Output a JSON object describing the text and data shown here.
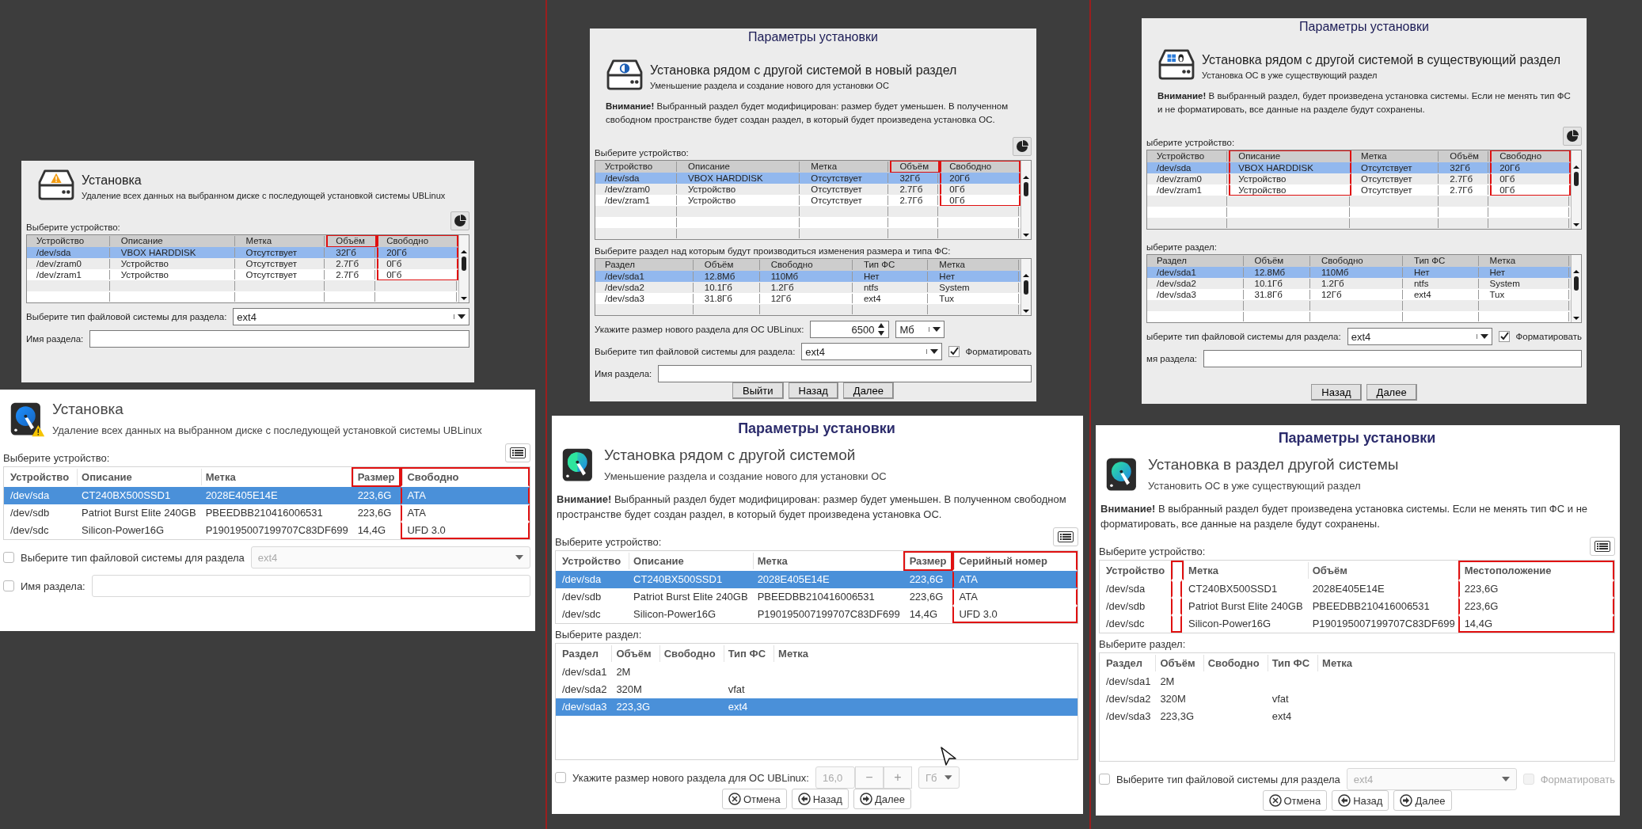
{
  "panels": [
    {
      "kind": "classic",
      "heading": "Установка",
      "subheading": "Удаление всех данных на выбранном диске с последующей установкой системы UBLinux",
      "device_prompt": "Выберите устройство:",
      "devices": {
        "columns": [
          {
            "label": "Устройство",
            "highlighted": false
          },
          {
            "label": "Описание",
            "highlighted": false
          },
          {
            "label": "Метка",
            "highlighted": false
          },
          {
            "label": "Объём",
            "highlighted": true,
            "rows_highlighted": false
          },
          {
            "label": "Свободно",
            "highlighted": true,
            "rows_highlighted": true
          }
        ],
        "rows": [
          {
            "cells": [
              "/dev/sda",
              "VBOX HARDDISK",
              "Отсутствует",
              "32Гб",
              "20Гб"
            ],
            "selected": true
          },
          {
            "cells": [
              "/dev/zram0",
              "Устройство",
              "Отсутствует",
              "2.7Гб",
              "0Гб"
            ],
            "selected": false
          },
          {
            "cells": [
              "/dev/zram1",
              "Устройство",
              "Отсутствует",
              "2.7Гб",
              "0Гб"
            ],
            "selected": false
          }
        ]
      },
      "fs_option": {
        "label": "Выберите тип файловой системы для раздела:",
        "value": "ext4"
      },
      "name_option": {
        "label": "Имя раздела:"
      }
    },
    {
      "kind": "modern",
      "heading": "Установка",
      "subheading": "Удаление всех данных на выбранном диске с последующей установкой системы UBLinux",
      "device_prompt": "Выберите устройство:",
      "devices": {
        "columns": [
          {
            "label": "Устройство",
            "highlighted": false
          },
          {
            "label": "Описание",
            "highlighted": false
          },
          {
            "label": "Метка",
            "highlighted": false
          },
          {
            "label": "Размер",
            "highlighted": true,
            "rows_highlighted": false
          },
          {
            "label": "Свободно",
            "highlighted": true,
            "rows_highlighted": true
          }
        ],
        "rows": [
          {
            "cells": [
              "/dev/sda",
              "CT240BX500SSD1",
              "2028E405E14E",
              "223,6G",
              "ATA"
            ],
            "selected": true
          },
          {
            "cells": [
              "/dev/sdb",
              "Patriot Burst Elite 240GB",
              "PBEEDBB210416006531",
              "223,6G",
              "ATA"
            ],
            "selected": false
          },
          {
            "cells": [
              "/dev/sdc",
              "Silicon-Power16G",
              "P190195007199707C83DF699",
              "14,4G",
              "UFD 3.0"
            ],
            "selected": false
          }
        ]
      },
      "fs_option": {
        "checked": false,
        "label": "Выберите тип файловой системы для раздела",
        "value": "ext4",
        "disabled": true
      },
      "name_option": {
        "checked": false,
        "label": "Имя раздела:"
      }
    },
    {
      "kind": "classic",
      "title": "Параметры установки",
      "heading": "Установка рядом с другой системой в новый раздел",
      "subheading": "Уменьшение раздела и создание нового для установки ОС",
      "warning": "**Внимание!** Выбранный раздел будет модифицирован: размер будет уменьшен. В полученном свободном пространстве будет создан раздел, в который будет произведена установка ОС.",
      "device_prompt": "Выберите устройство:",
      "devices": {
        "columns": [
          {
            "label": "Устройство",
            "highlighted": false
          },
          {
            "label": "Описание",
            "highlighted": false
          },
          {
            "label": "Метка",
            "highlighted": false
          },
          {
            "label": "Объём",
            "highlighted": true,
            "rows_highlighted": false
          },
          {
            "label": "Свободно",
            "highlighted": true,
            "rows_highlighted": true
          }
        ],
        "rows": [
          {
            "cells": [
              "/dev/sda",
              "VBOX HARDDISK",
              "Отсутствует",
              "32Гб",
              "20Гб"
            ],
            "selected": true
          },
          {
            "cells": [
              "/dev/zram0",
              "Устройство",
              "Отсутствует",
              "2.7Гб",
              "0Гб"
            ],
            "selected": false
          },
          {
            "cells": [
              "/dev/zram1",
              "Устройство",
              "Отсутствует",
              "2.7Гб",
              "0Гб"
            ],
            "selected": false
          }
        ]
      },
      "partition_prompt": "Выберите раздел над которым будут производиться изменения размера и типа ФС:",
      "partitions": {
        "columns": [
          {
            "label": "Раздел",
            "highlighted": false
          },
          {
            "label": "Объём",
            "highlighted": false
          },
          {
            "label": "Свободно",
            "highlighted": false
          },
          {
            "label": "Тип ФС",
            "highlighted": false
          },
          {
            "label": "Метка",
            "highlighted": false
          }
        ],
        "rows": [
          {
            "cells": [
              "/dev/sda1",
              "12.8Мб",
              "110Мб",
              "Нет",
              "Нет"
            ],
            "selected": true
          },
          {
            "cells": [
              "/dev/sda2",
              "10.1Гб",
              "1.2Гб",
              "ntfs",
              "System"
            ],
            "selected": false
          },
          {
            "cells": [
              "/dev/sda3",
              "31.8Гб",
              "12Гб",
              "ext4",
              "Tux"
            ],
            "selected": false
          }
        ]
      },
      "size_option": {
        "label": "Укажите размер нового раздела для ОС UBLinux:",
        "value": "6500",
        "unit": "Мб"
      },
      "fs_option": {
        "label": "Выберите тип файловой системы для раздела:",
        "value": "ext4",
        "format": {
          "label": "Форматировать",
          "checked": true
        }
      },
      "name_option": {
        "label": "Имя раздела:"
      },
      "buttons": [
        {
          "kind": "exit",
          "label": "Выйти"
        },
        {
          "kind": "back",
          "label": "Назад"
        },
        {
          "kind": "next",
          "label": "Далее"
        }
      ]
    },
    {
      "kind": "modern",
      "title": "Параметры установки",
      "heading": "Установка рядом с другой системой",
      "subheading": "Уменьшение раздела и создание нового для установки ОС",
      "warning": "**Внимание!** Выбранный раздел будет модифицирован: размер будет уменьшен. В полученном свободном пространстве будет создан раздел, в который будет произведена установка ОС.",
      "device_prompt": "Выберите устройство:",
      "devices": {
        "columns": [
          {
            "label": "Устройство",
            "highlighted": false
          },
          {
            "label": "Описание",
            "highlighted": false
          },
          {
            "label": "Метка",
            "highlighted": false
          },
          {
            "label": "Размер",
            "highlighted": true,
            "rows_highlighted": false
          },
          {
            "label": "Серийный номер",
            "highlighted": true,
            "rows_highlighted": true
          }
        ],
        "rows": [
          {
            "cells": [
              "/dev/sda",
              "CT240BX500SSD1",
              "2028E405E14E",
              "223,6G",
              "ATA"
            ],
            "selected": true
          },
          {
            "cells": [
              "/dev/sdb",
              "Patriot Burst Elite 240GB",
              "PBEEDBB210416006531",
              "223,6G",
              "ATA"
            ],
            "selected": false
          },
          {
            "cells": [
              "/dev/sdc",
              "Silicon-Power16G",
              "P190195007199707C83DF699",
              "14,4G",
              "UFD 3.0"
            ],
            "selected": false
          }
        ]
      },
      "partition_prompt": "Выберите раздел:",
      "partitions": {
        "columns": [
          {
            "label": "Раздел",
            "highlighted": false
          },
          {
            "label": "Объём",
            "highlighted": false
          },
          {
            "label": "Свободно",
            "highlighted": false
          },
          {
            "label": "Тип ФС",
            "highlighted": false
          },
          {
            "label": "Метка",
            "highlighted": false
          }
        ],
        "rows": [
          {
            "cells": [
              "/dev/sda1",
              "2M",
              null,
              null,
              null
            ],
            "selected": false
          },
          {
            "cells": [
              "/dev/sda2",
              "320M",
              null,
              "vfat",
              null
            ],
            "selected": false
          },
          {
            "cells": [
              "/dev/sda3",
              "223,3G",
              null,
              "ext4",
              null
            ],
            "selected": true
          }
        ]
      },
      "size_option": {
        "checked": false,
        "label": "Укажите размер нового раздела для ОС UBLinux:",
        "value": "16,0",
        "stepper": [
          "−",
          "+"
        ],
        "unit": "Гб",
        "disabled": true
      },
      "buttons": [
        {
          "kind": "cancel",
          "label": "Отмена"
        },
        {
          "kind": "back",
          "label": "Назад"
        },
        {
          "kind": "next",
          "label": "Далее"
        }
      ]
    },
    {
      "kind": "classic",
      "title": "Параметры установки",
      "heading": "Установка рядом с другой системой в существующий раздел",
      "subheading": "Установка ОС в уже существующий раздел",
      "warning": "**Внимание!** В выбранный раздел, будет произведена установка системы. Если не менять тип ФС и не форматировать, все данные на разделе будут сохранены.",
      "device_prompt": "ыберите устройство:",
      "devices": {
        "columns": [
          {
            "label": "Устройство",
            "highlighted": false
          },
          {
            "label": "Описание",
            "highlighted": true,
            "rows_highlighted": true
          },
          {
            "label": "Метка",
            "highlighted": false
          },
          {
            "label": "Объём",
            "highlighted": false
          },
          {
            "label": "Свободно",
            "highlighted": true,
            "rows_highlighted": true
          }
        ],
        "rows": [
          {
            "cells": [
              "/dev/sda",
              "VBOX HARDDISK",
              "Отсутствует",
              "32Гб",
              "20Гб"
            ],
            "selected": true
          },
          {
            "cells": [
              "/dev/zram0",
              "Устройство",
              "Отсутствует",
              "2.7Гб",
              "0Гб"
            ],
            "selected": false
          },
          {
            "cells": [
              "/dev/zram1",
              "Устройство",
              "Отсутствует",
              "2.7Гб",
              "0Гб"
            ],
            "selected": false
          }
        ]
      },
      "partition_prompt": "ыберите раздел:",
      "partitions": {
        "columns": [
          {
            "label": "Раздел",
            "highlighted": false
          },
          {
            "label": "Объём",
            "highlighted": false
          },
          {
            "label": "Свободно",
            "highlighted": false
          },
          {
            "label": "Тип ФС",
            "highlighted": false
          },
          {
            "label": "Метка",
            "highlighted": false
          }
        ],
        "rows": [
          {
            "cells": [
              "/dev/sda1",
              "12.8Мб",
              "110Мб",
              "Нет",
              "Нет"
            ],
            "selected": true
          },
          {
            "cells": [
              "/dev/sda2",
              "10.1Гб",
              "1.2Гб",
              "ntfs",
              "System"
            ],
            "selected": false
          },
          {
            "cells": [
              "/dev/sda3",
              "31.8Гб",
              "12Гб",
              "ext4",
              "Tux"
            ],
            "selected": false
          }
        ]
      },
      "fs_option": {
        "label": "ыберите тип файловой системы для раздела:",
        "value": "ext4",
        "format": {
          "label": "Форматировать",
          "checked": true
        }
      },
      "name_option": {
        "label": "мя раздела:"
      },
      "buttons": [
        {
          "kind": "back",
          "label": "Назад"
        },
        {
          "kind": "next",
          "label": "Далее"
        }
      ]
    },
    {
      "kind": "modern",
      "title": "Параметры установки",
      "heading": "Установка в раздел другой системы",
      "subheading": "Установить ОС в уже существующий раздел",
      "warning": "**Внимание!** В выбранный раздел будет произведена установка системы. Если не менять тип ФС и не форматировать, все данные на разделе будут сохранены.",
      "device_prompt": "Выберите устройство:",
      "devices": {
        "columns": [
          {
            "label": "Устройство",
            "highlighted": false
          },
          {
            "highlighted": true,
            "rows_highlighted": true
          },
          {
            "label": "Метка",
            "highlighted": false
          },
          {
            "label": "Объём",
            "highlighted": false
          },
          {
            "label": "Местоположение",
            "highlighted": true,
            "rows_highlighted": true
          }
        ],
        "rows": [
          {
            "cells": [
              "/dev/sda",
              null,
              "CT240BX500SSD1",
              "2028E405E14E",
              "223,6G"
            ],
            "selected": false
          },
          {
            "cells": [
              "/dev/sdb",
              null,
              "Patriot Burst Elite 240GB",
              "PBEEDBB210416006531",
              "223,6G"
            ],
            "selected": false
          },
          {
            "cells": [
              "/dev/sdc",
              null,
              "Silicon-Power16G",
              "P190195007199707C83DF699",
              "14,4G"
            ],
            "selected": false
          }
        ]
      },
      "partition_prompt": "Выберите раздел:",
      "partitions": {
        "columns": [
          {
            "label": "Раздел",
            "highlighted": false
          },
          {
            "label": "Объём",
            "highlighted": false
          },
          {
            "label": "Свободно",
            "highlighted": false
          },
          {
            "label": "Тип ФС",
            "highlighted": false
          },
          {
            "label": "Метка",
            "highlighted": false
          }
        ],
        "rows": [
          {
            "cells": [
              "/dev/sda1",
              "2M",
              null,
              null,
              null
            ],
            "selected": false
          },
          {
            "cells": [
              "/dev/sda2",
              "320M",
              null,
              "vfat",
              null
            ],
            "selected": false
          },
          {
            "cells": [
              "/dev/sda3",
              "223,3G",
              null,
              "ext4",
              null
            ],
            "selected": false
          }
        ]
      },
      "fs_option": {
        "checked": false,
        "label": "Выберите тип файловой системы для раздела",
        "value": "ext4",
        "disabled": true,
        "format": {
          "label": "Форматировать",
          "checked": false,
          "disabled": true
        }
      },
      "buttons": [
        {
          "kind": "cancel",
          "label": "Отмена"
        },
        {
          "kind": "back",
          "label": "Назад"
        },
        {
          "kind": "next",
          "label": "Далее"
        }
      ]
    }
  ]
}
